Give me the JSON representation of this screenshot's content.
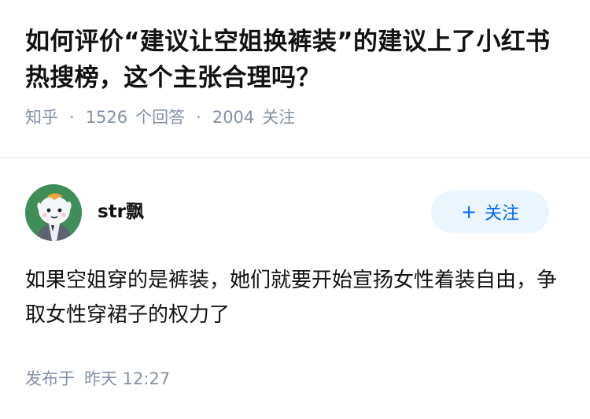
{
  "question": {
    "title": "如何评价“建议让空姐换裤装”的建议上了小红书热搜榜，这个主张合理吗？",
    "site": "知乎",
    "answers_count": "1526",
    "answers_label": "个回答",
    "followers_count": "2004",
    "followers_label": "关注",
    "separator": "·"
  },
  "answer": {
    "author_name": "str飘",
    "avatar_icon": "cartoon-avatar",
    "follow_button": {
      "icon": "plus-icon",
      "label": "关注"
    },
    "content": "如果空姐穿的是裤装，她们就要开始宣扬女性着装自由，争取女性穿裙子的权力了",
    "published_label": "发布于",
    "published_time": "昨天 12:27"
  },
  "colors": {
    "accent": "#0066ff",
    "follow_bg": "#ebf5fd",
    "meta_text": "#8590a6",
    "avatar_bg": "#3f8d58"
  }
}
